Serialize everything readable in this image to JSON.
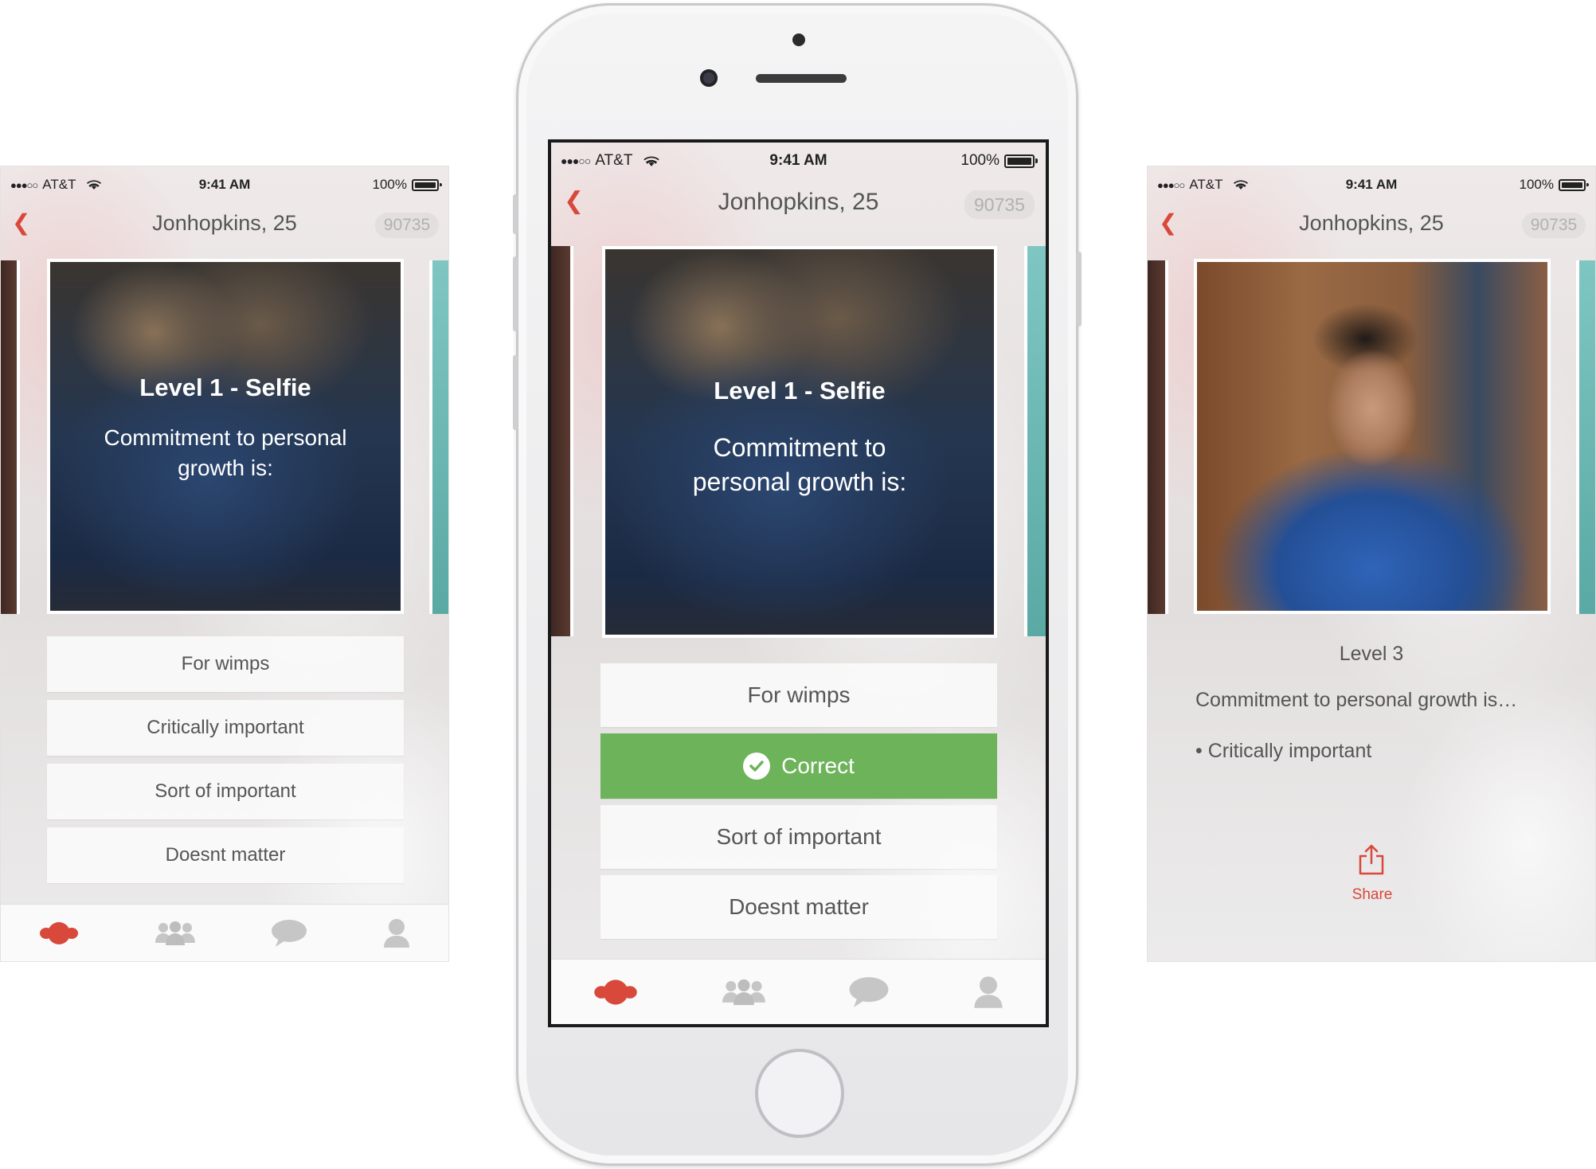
{
  "status": {
    "carrier": "AT&T",
    "signal": "●●●○○",
    "time": "9:41 AM",
    "battery": "100%"
  },
  "nav": {
    "title": "Jonhopkins, 25",
    "zip": "90735"
  },
  "question": {
    "level": "Level 1 - Selfie",
    "text": "Commitment to personal growth is:"
  },
  "answers": [
    "For wimps",
    "Critically important",
    "Sort of important",
    "Doesnt matter"
  ],
  "center_answers": {
    "a1": "For wimps",
    "correct": "Correct",
    "a3": "Sort of important",
    "a4": "Doesnt matter"
  },
  "result": {
    "level": "Level 3",
    "question": "Commitment to personal growth is…",
    "answer": "• Critically important",
    "share_label": "Share"
  },
  "tabs": [
    "game-icon",
    "groups-icon",
    "chat-icon",
    "profile-icon"
  ],
  "colors": {
    "accent": "#d8483b",
    "correct": "#6db35a"
  }
}
